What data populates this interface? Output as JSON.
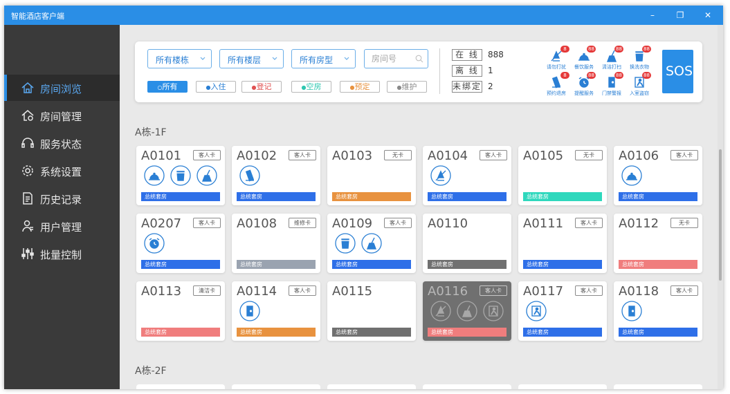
{
  "window": {
    "title": "智能酒店客户端",
    "controls": {
      "minimize": "–",
      "restore": "❐",
      "close": "✕"
    }
  },
  "sidebar": {
    "items": [
      {
        "label": "房间浏览",
        "icon": "home-icon",
        "active": true
      },
      {
        "label": "房间管理",
        "icon": "home-settings-icon",
        "active": false
      },
      {
        "label": "服务状态",
        "icon": "headset-icon",
        "active": false
      },
      {
        "label": "系统设置",
        "icon": "gear-icon",
        "active": false
      },
      {
        "label": "历史记录",
        "icon": "document-icon",
        "active": false
      },
      {
        "label": "用户管理",
        "icon": "user-icon",
        "active": false
      },
      {
        "label": "批量控制",
        "icon": "sliders-icon",
        "active": false
      }
    ]
  },
  "filters": {
    "dropdowns": [
      "所有楼栋",
      "所有楼层",
      "所有房型"
    ],
    "room_search_placeholder": "房间号",
    "status_chips": [
      {
        "label": "所有",
        "prefix": "○",
        "color": "#2a8ee6",
        "filled": true
      },
      {
        "label": "入住",
        "prefix": "●",
        "color": "#2a7fd4",
        "filled": false
      },
      {
        "label": "登记",
        "prefix": "●",
        "color": "#e05252",
        "filled": false
      },
      {
        "label": "空房",
        "prefix": "●",
        "color": "#2fc7b0",
        "filled": false
      },
      {
        "label": "预定",
        "prefix": "●",
        "color": "#e8923f",
        "filled": false
      },
      {
        "label": "维护",
        "prefix": "●",
        "color": "#8a8a8a",
        "filled": false
      }
    ]
  },
  "stats": [
    {
      "label": "在 线",
      "value": "888"
    },
    {
      "label": "离 线",
      "value": "1"
    },
    {
      "label": "未绑定",
      "value": "2"
    }
  ],
  "services": [
    {
      "label": "请勿打扰",
      "badge": "8",
      "icon": "do-not-disturb-icon"
    },
    {
      "label": "餐饮服务",
      "badge": "88",
      "icon": "dining-bell-icon"
    },
    {
      "label": "清洁打扫",
      "badge": "88",
      "icon": "broom-icon"
    },
    {
      "label": "换洗衣物",
      "badge": "88",
      "icon": "laundry-icon"
    },
    {
      "label": "预约退房",
      "badge": "8",
      "icon": "checkout-icon"
    },
    {
      "label": "提醒服务",
      "badge": "88",
      "icon": "alarm-clock-icon"
    },
    {
      "label": "门禁警报",
      "badge": "88",
      "icon": "door-alarm-icon"
    },
    {
      "label": "入室盗窃",
      "badge": "88",
      "icon": "intrusion-icon"
    }
  ],
  "sos_label": "SOS",
  "colors": {
    "blue": "#2e6fe8",
    "orange": "#e8923f",
    "teal": "#2fd8bd",
    "gray": "#9aa3b0",
    "darkgray": "#707070",
    "red": "#f07d7d",
    "accent": "#2a8ee6"
  },
  "floors": [
    {
      "label": "A栋-1F",
      "rooms": [
        {
          "number": "A0101",
          "tag": "客人卡",
          "type": "总统套房",
          "type_color": "blue",
          "icons": [
            "dining-bell-icon",
            "laundry-icon",
            "broom-icon"
          ]
        },
        {
          "number": "A0102",
          "tag": "客人卡",
          "type": "总统套房",
          "type_color": "blue",
          "icons": [
            "checkout-icon"
          ]
        },
        {
          "number": "A0103",
          "tag": "无卡",
          "type": "总统套房",
          "type_color": "orange",
          "icons": []
        },
        {
          "number": "A0104",
          "tag": "客人卡",
          "type": "总统套房",
          "type_color": "blue",
          "icons": [
            "do-not-disturb-icon"
          ]
        },
        {
          "number": "A0105",
          "tag": "无卡",
          "type": "总统套房",
          "type_color": "teal",
          "icons": []
        },
        {
          "number": "A0106",
          "tag": "客人卡",
          "type": "总统套房",
          "type_color": "blue",
          "icons": [
            "dining-bell-icon"
          ]
        },
        {
          "number": "A0207",
          "tag": "客人卡",
          "type": "总统套房",
          "type_color": "blue",
          "icons": [
            "alarm-clock-icon"
          ]
        },
        {
          "number": "A0108",
          "tag": "维修卡",
          "type": "总统套房",
          "type_color": "gray",
          "icons": []
        },
        {
          "number": "A0109",
          "tag": "客人卡",
          "type": "总统套房",
          "type_color": "blue",
          "icons": [
            "laundry-icon",
            "broom-icon"
          ]
        },
        {
          "number": "A0110",
          "tag": "",
          "type": "总统套房",
          "type_color": "darkgray",
          "icons": []
        },
        {
          "number": "A0111",
          "tag": "客人卡",
          "type": "总统套房",
          "type_color": "blue",
          "icons": []
        },
        {
          "number": "A0112",
          "tag": "无卡",
          "type": "总统套房",
          "type_color": "red",
          "icons": []
        },
        {
          "number": "A0113",
          "tag": "清洁卡",
          "type": "总统套房",
          "type_color": "red",
          "icons": []
        },
        {
          "number": "A0114",
          "tag": "客人卡",
          "type": "总统套房",
          "type_color": "orange",
          "icons": [
            "door-alarm-icon"
          ]
        },
        {
          "number": "A0115",
          "tag": "",
          "type": "总统套房",
          "type_color": "darkgray",
          "icons": []
        },
        {
          "number": "A0116",
          "tag": "客人卡",
          "type": "总统套房",
          "type_color": "red",
          "icons": [
            "do-not-disturb-icon",
            "broom-icon",
            "intrusion-icon"
          ],
          "disabled": true
        },
        {
          "number": "A0117",
          "tag": "客人卡",
          "type": "总统套房",
          "type_color": "blue",
          "icons": [
            "intrusion-icon"
          ]
        },
        {
          "number": "A0118",
          "tag": "客人卡",
          "type": "总统套房",
          "type_color": "blue",
          "icons": [
            "door-alarm-icon"
          ]
        }
      ]
    },
    {
      "label": "A栋-2F",
      "rooms": []
    }
  ]
}
